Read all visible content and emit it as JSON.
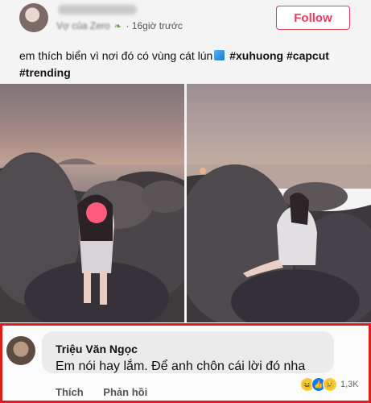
{
  "post": {
    "author_display": "",
    "meta_prefix": "Vợ của Zero",
    "time": "· 16giờ trước",
    "follow_label": "Follow",
    "caption_text": "em thích biển vì nơi đó có vùng cát lún",
    "hashtags": "#xuhuong #capcut",
    "hashtag_line2": "#trending"
  },
  "comment": {
    "author": "Triệu Văn Ngọc",
    "text": "Em nói hay lắm. Để anh chôn cái lời đó nha",
    "reaction_count": "1,3K",
    "like_label": "Thích",
    "reply_label": "Phản hồi"
  },
  "colors": {
    "follow_accent": "#ee3b5d",
    "highlight_border": "#e31b1b"
  }
}
